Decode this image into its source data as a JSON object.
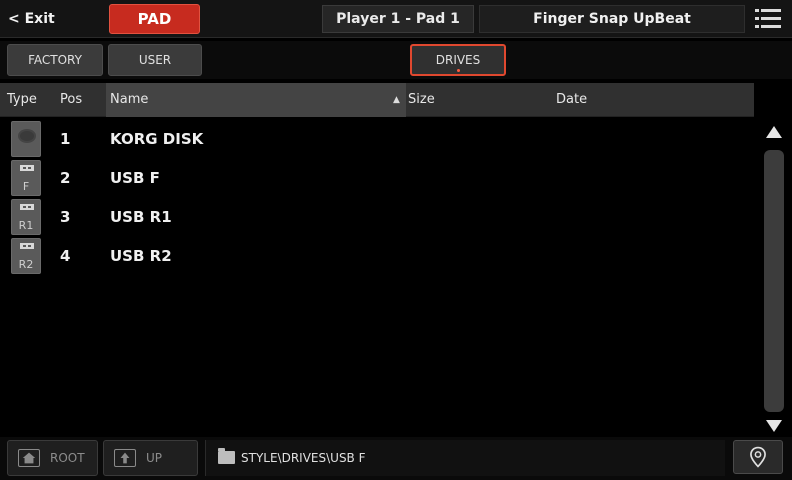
{
  "topbar": {
    "exit_label": "< Exit",
    "pad_label": "PAD",
    "player_label": "Player 1 - Pad 1",
    "sound_name": "Finger Snap UpBeat"
  },
  "tabs": {
    "factory": "FACTORY",
    "user": "USER",
    "drives": "DRIVES"
  },
  "table": {
    "headers": {
      "type": "Type",
      "pos": "Pos",
      "name": "Name",
      "size": "Size",
      "date": "Date"
    },
    "sort_indicator": "▲",
    "rows": [
      {
        "icon": "disk-drive-icon",
        "icon_label": "",
        "pos": "1",
        "name": "KORG DISK"
      },
      {
        "icon": "usb-drive-icon",
        "icon_label": "F",
        "pos": "2",
        "name": "USB F"
      },
      {
        "icon": "usb-drive-icon",
        "icon_label": "R1",
        "pos": "3",
        "name": "USB R1"
      },
      {
        "icon": "usb-drive-icon",
        "icon_label": "R2",
        "pos": "4",
        "name": "USB R2"
      }
    ]
  },
  "bottombar": {
    "root_label": "ROOT",
    "up_label": "UP",
    "path": "STYLE\\DRIVES\\USB F"
  },
  "colors": {
    "accent_red": "#c72b1f",
    "selected_tab_border": "#e0482f"
  }
}
